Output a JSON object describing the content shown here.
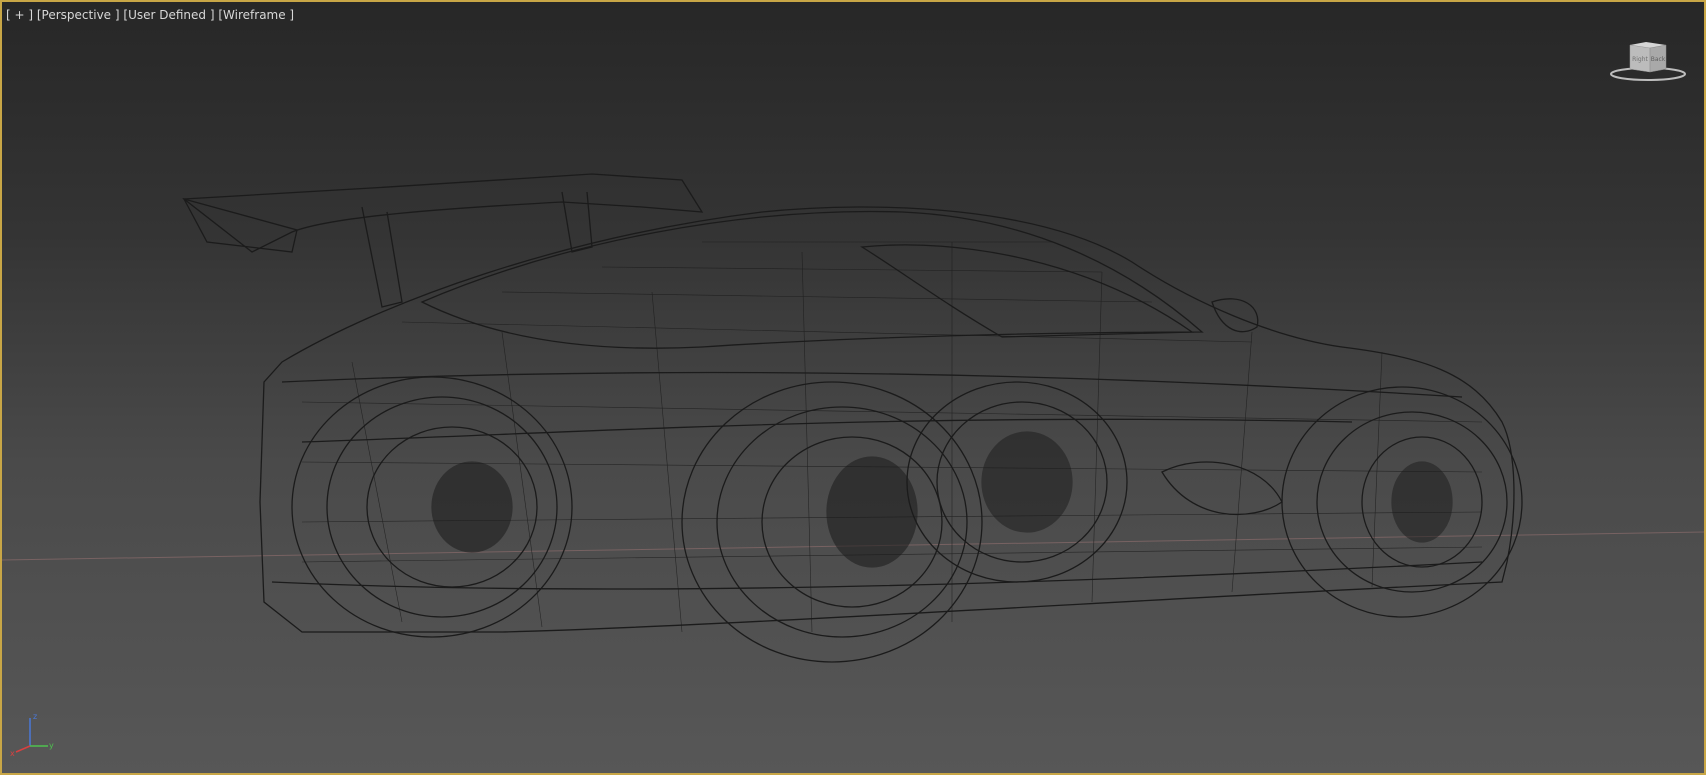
{
  "viewport": {
    "labels": {
      "plus": "[ + ]",
      "view": "[Perspective ]",
      "camera": "[User Defined ]",
      "shading": "[Wireframe ]"
    },
    "viewcube": {
      "face_left": "Right",
      "face_right": "Back"
    },
    "axis": {
      "x": "x",
      "y": "y",
      "z": "z"
    },
    "colors": {
      "active_border": "#c8a646",
      "wireframe": "#1b1b1b",
      "grid_line": "#8a6b6b",
      "label_text": "#d8d8d8"
    }
  }
}
